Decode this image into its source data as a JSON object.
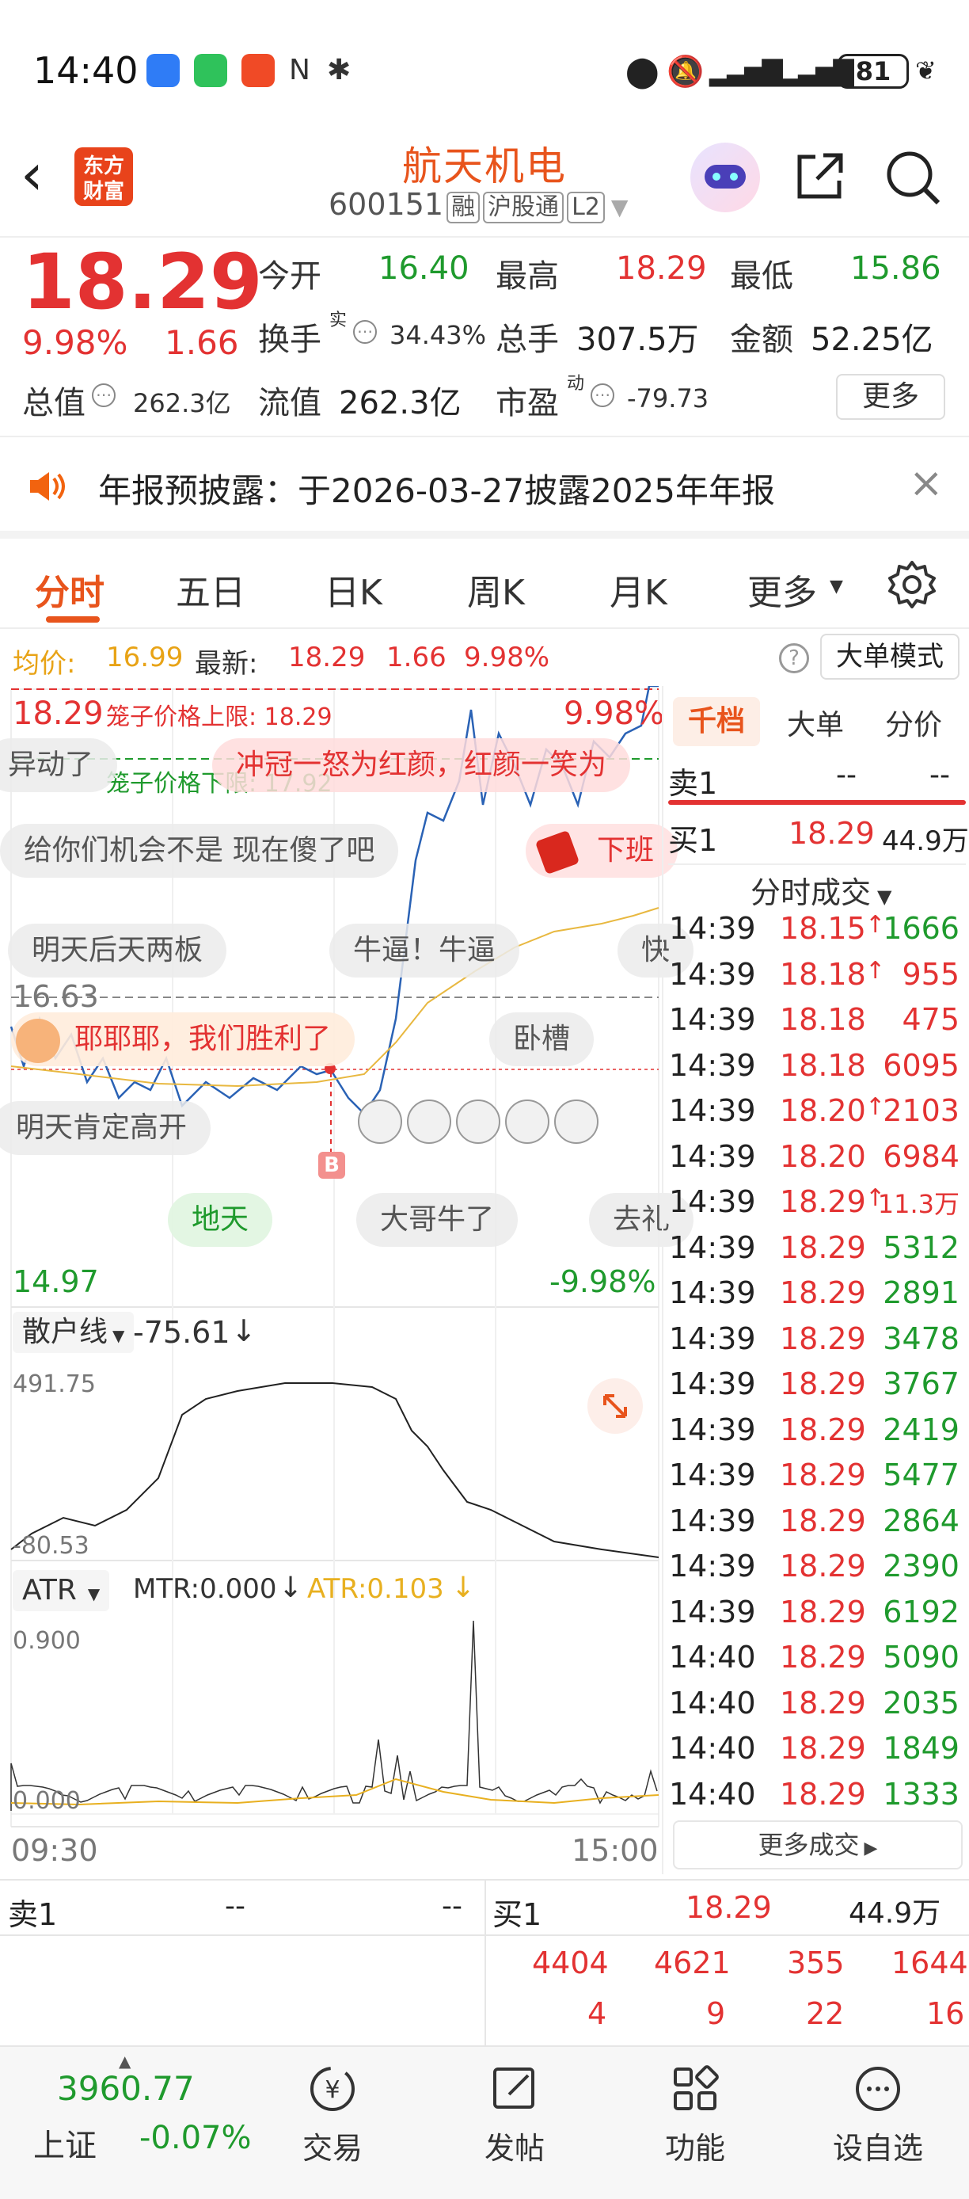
{
  "status_bar": {
    "time": "14:40",
    "battery": "81"
  },
  "header": {
    "logo_text": "东方\n财富",
    "stock_name": "航天机电",
    "stock_code": "600151",
    "tags": [
      "融",
      "沪股通",
      "L2"
    ]
  },
  "quote": {
    "price": "18.29",
    "pct_change": "9.98%",
    "change": "1.66",
    "open_label": "今开",
    "open": "16.40",
    "high_label": "最高",
    "high": "18.29",
    "low_label": "最低",
    "low": "15.86",
    "turnover_label": "换手",
    "turnover_sup": "实",
    "turnover": "34.43%",
    "volume_label": "总手",
    "volume": "307.5万",
    "amount_label": "金额",
    "amount": "52.25亿",
    "mktcap_label": "总值",
    "mktcap": "262.3亿",
    "float_label": "流值",
    "float_cap": "262.3亿",
    "pe_label": "市盈",
    "pe_sup": "动",
    "pe": "-79.73",
    "more_button": "更多"
  },
  "notice": {
    "text": "年报预披露：于2026-03-27披露2025年年报"
  },
  "tabs": [
    "分时",
    "五日",
    "日K",
    "周K",
    "月K",
    "更多"
  ],
  "chart_info": {
    "avg_label": "均价:",
    "avg": "16.99",
    "latest_label": "最新:",
    "latest": "18.29",
    "latest_change": "1.66",
    "latest_pct": "9.98%",
    "mode_button": "大单模式",
    "top_price": "18.29",
    "top_pct": "9.98%",
    "upper_limit_label": "笼子价格上限: 18.29",
    "lower_limit_label": "笼子价格下限: 17.92",
    "mid_price": "16.63",
    "bottom_price": "14.97",
    "bottom_pct": "-9.98%",
    "time_start": "09:30",
    "time_end": "15:00",
    "buy_marker": "B"
  },
  "danmaku": [
    "异动了",
    "冲冠一怒为红颜，红颜一笑为",
    "给你们机会不是 现在傻了吧",
    "下班",
    "明天后天两板",
    "牛逼！牛逼",
    "快",
    "耶耶耶，我们胜利了",
    "卧槽",
    "明天肯定高开",
    "地天",
    "大哥牛了",
    "去礼"
  ],
  "indicator1": {
    "name": "散户线",
    "value": "-75.61",
    "max": "491.75",
    "min": "-80.53"
  },
  "indicator2": {
    "name": "ATR",
    "mtr_label": "MTR:0.000",
    "atr_label": "ATR:0.103",
    "max": "0.900",
    "min": "0.000"
  },
  "side_tabs": [
    "千档",
    "大单",
    "分价"
  ],
  "order_book": {
    "sell1_label": "卖1",
    "sell1_price": "--",
    "sell1_vol": "--",
    "buy1_label": "买1",
    "buy1_price": "18.29",
    "buy1_vol": "44.9万"
  },
  "trades_title": "分时成交",
  "trades": [
    {
      "time": "14:39",
      "price": "18.15",
      "vol": "1666",
      "arrow": "↑",
      "color": "red-green"
    },
    {
      "time": "14:39",
      "price": "18.18",
      "vol": "955",
      "arrow": "↑",
      "color": "red-red"
    },
    {
      "time": "14:39",
      "price": "18.18",
      "vol": "475",
      "arrow": "",
      "color": "red-red"
    },
    {
      "time": "14:39",
      "price": "18.18",
      "vol": "6095",
      "arrow": "",
      "color": "red-red"
    },
    {
      "time": "14:39",
      "price": "18.20",
      "vol": "2103",
      "arrow": "↑",
      "color": "red-red"
    },
    {
      "time": "14:39",
      "price": "18.20",
      "vol": "6984",
      "arrow": "",
      "color": "red-red"
    },
    {
      "time": "14:39",
      "price": "18.29",
      "vol": "11.3万",
      "arrow": "↑",
      "color": "red-red"
    },
    {
      "time": "14:39",
      "price": "18.29",
      "vol": "5312",
      "arrow": "",
      "color": "red-green"
    },
    {
      "time": "14:39",
      "price": "18.29",
      "vol": "2891",
      "arrow": "",
      "color": "red-green"
    },
    {
      "time": "14:39",
      "price": "18.29",
      "vol": "3478",
      "arrow": "",
      "color": "red-green"
    },
    {
      "time": "14:39",
      "price": "18.29",
      "vol": "3767",
      "arrow": "",
      "color": "red-green"
    },
    {
      "time": "14:39",
      "price": "18.29",
      "vol": "2419",
      "arrow": "",
      "color": "red-green"
    },
    {
      "time": "14:39",
      "price": "18.29",
      "vol": "5477",
      "arrow": "",
      "color": "red-green"
    },
    {
      "time": "14:39",
      "price": "18.29",
      "vol": "2864",
      "arrow": "",
      "color": "red-green"
    },
    {
      "time": "14:39",
      "price": "18.29",
      "vol": "2390",
      "arrow": "",
      "color": "red-green"
    },
    {
      "time": "14:39",
      "price": "18.29",
      "vol": "6192",
      "arrow": "",
      "color": "red-green"
    },
    {
      "time": "14:40",
      "price": "18.29",
      "vol": "5090",
      "arrow": "",
      "color": "red-green"
    },
    {
      "time": "14:40",
      "price": "18.29",
      "vol": "2035",
      "arrow": "",
      "color": "red-green"
    },
    {
      "time": "14:40",
      "price": "18.29",
      "vol": "1849",
      "arrow": "",
      "color": "red-green"
    },
    {
      "time": "14:40",
      "price": "18.29",
      "vol": "1333",
      "arrow": "",
      "color": "red-green"
    }
  ],
  "more_trades": "更多成交",
  "bottom_book": {
    "sell1_label": "卖1",
    "sell1_price": "--",
    "sell1_vol": "--",
    "buy1_label": "买1",
    "buy1_price": "18.29",
    "buy1_vol": "44.9万",
    "row2": [
      "4404",
      "4621",
      "355",
      "1644"
    ],
    "row3": [
      "4",
      "9",
      "22",
      "16"
    ]
  },
  "bottom_nav": {
    "index_value": "3960.77",
    "index_name": "上证",
    "index_change": "-0.07%",
    "items": [
      "交易",
      "发帖",
      "功能",
      "设自选"
    ]
  },
  "colors": {
    "up": "#e33232",
    "down": "#1f9a2d",
    "brand": "#e8541c",
    "price_line": "#2a62b5",
    "avg_line": "#e8b840"
  }
}
